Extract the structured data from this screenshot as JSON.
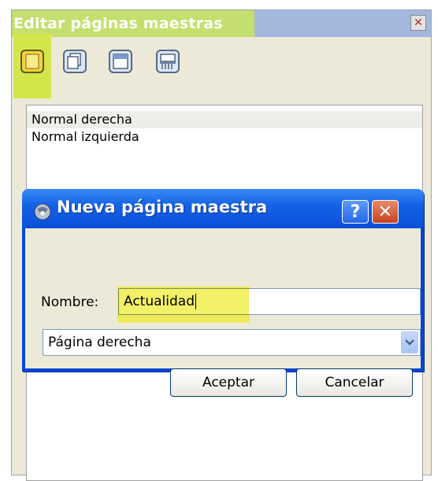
{
  "palette": {
    "title": "Editar páginas maestras",
    "close_glyph": "✕",
    "toolbar": [
      {
        "icon": "new-page-icon"
      },
      {
        "icon": "duplicate-page-icon"
      },
      {
        "icon": "load-page-icon"
      },
      {
        "icon": "delete-page-icon"
      }
    ],
    "items": [
      {
        "label": "Normal derecha",
        "selected": true
      },
      {
        "label": "Normal izquierda",
        "selected": false
      }
    ]
  },
  "dialog": {
    "title": "Nueva página maestra",
    "help_glyph": "?",
    "close_glyph": "✕",
    "name_label": "Nombre:",
    "name_value": "Actualidad",
    "page_type": "Página derecha",
    "ok_label": "Aceptar",
    "cancel_label": "Cancelar"
  },
  "colors": {
    "highlight": "#d6e44b",
    "xp_blue": "#0a46d6"
  }
}
